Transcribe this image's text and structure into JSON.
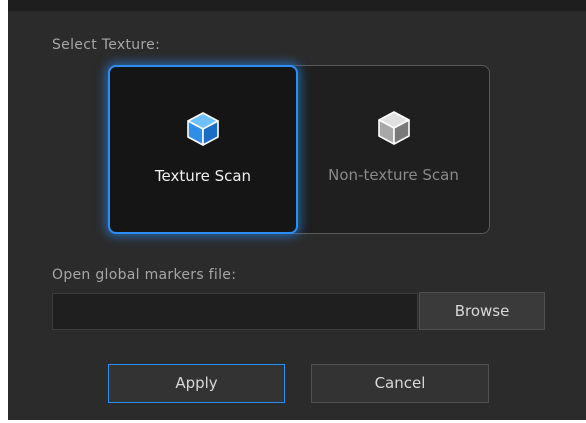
{
  "texture": {
    "section_label": "Select Texture:",
    "options": [
      {
        "label": "Texture Scan",
        "icon": "cube-icon",
        "selected": true
      },
      {
        "label": "Non-texture Scan",
        "icon": "cube-icon",
        "selected": false
      }
    ]
  },
  "markers": {
    "section_label": "Open global markers file:",
    "file_path_value": "",
    "browse_label": "Browse"
  },
  "actions": {
    "apply_label": "Apply",
    "cancel_label": "Cancel"
  },
  "colors": {
    "background": "#2b2b2b",
    "accent": "#2c8df5",
    "selected_cube": "#2f8fe8",
    "unselected_cube": "#b0b0b0"
  }
}
